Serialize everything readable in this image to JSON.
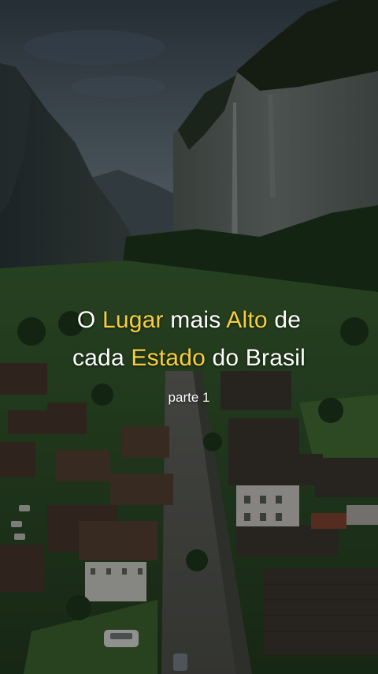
{
  "caption": {
    "line1": [
      {
        "text": "O ",
        "highlight": false
      },
      {
        "text": "Lugar",
        "highlight": true
      },
      {
        "text": " mais ",
        "highlight": false
      },
      {
        "text": "Alto",
        "highlight": true
      },
      {
        "text": " de",
        "highlight": false
      }
    ],
    "line2": [
      {
        "text": "cada ",
        "highlight": false
      },
      {
        "text": "Estado",
        "highlight": true
      },
      {
        "text": " do Brasil",
        "highlight": false
      }
    ],
    "highlight_color": "#f7cd3d",
    "text_color": "#ffffff"
  },
  "subtitle": "parte 1"
}
